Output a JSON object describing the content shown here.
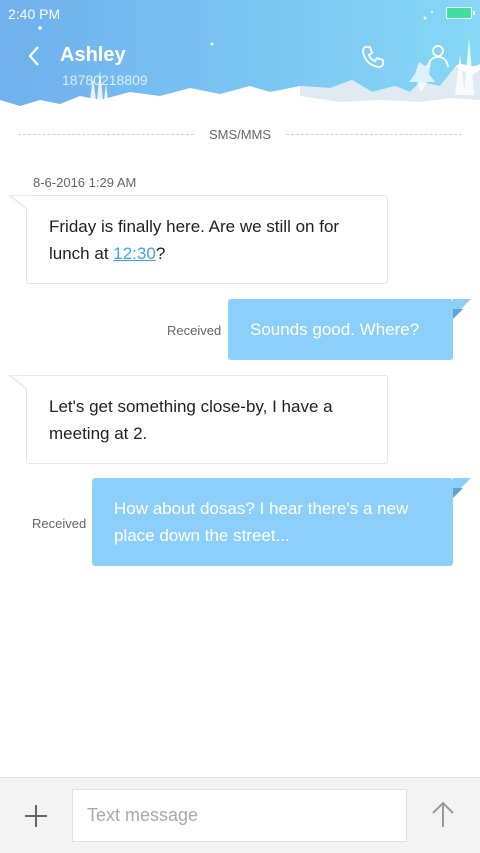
{
  "status_bar": {
    "time": "2:40 PM"
  },
  "header": {
    "contact_name": "Ashley",
    "contact_number": "18780218809"
  },
  "thread": {
    "channel_label": "SMS/MMS",
    "date": "8-6-2016 1:29 AM",
    "messages": [
      {
        "direction": "incoming",
        "text_before": "Friday is finally here. Are we still on for lunch at ",
        "link": "12:30",
        "text_after": "?"
      },
      {
        "direction": "outgoing",
        "text": "Sounds good. Where?",
        "status": "Received"
      },
      {
        "direction": "incoming",
        "text": "Let's get something close-by, I have a meeting at 2."
      },
      {
        "direction": "outgoing",
        "text": "How about dosas? I hear there's a new place down the street...",
        "status": "Received"
      }
    ]
  },
  "composer": {
    "placeholder": "Text message"
  },
  "colors": {
    "header_sky": "#7cc4f2",
    "outgoing_bubble": "#8ccffa",
    "link": "#3aa8e8",
    "battery": "#41e0a0"
  },
  "icons": [
    "back-arrow-icon",
    "phone-icon",
    "contact-icon",
    "plus-icon",
    "send-arrow-icon"
  ]
}
